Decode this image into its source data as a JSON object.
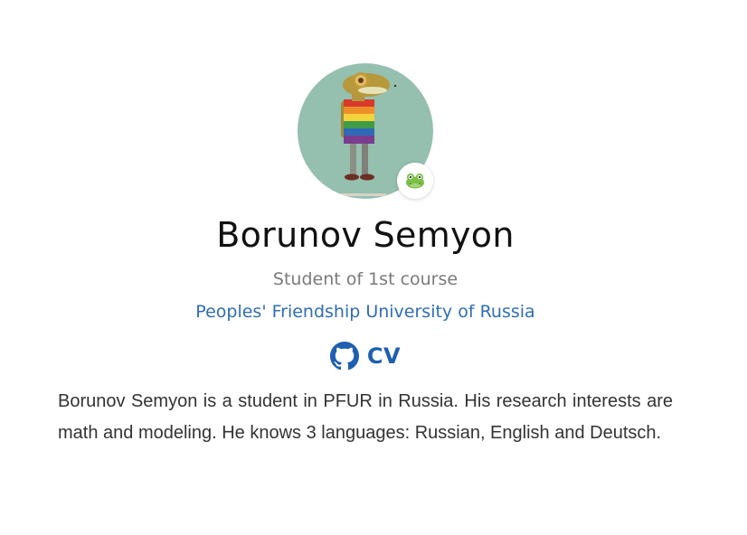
{
  "profile": {
    "name": "Borunov Semyon",
    "role": "Student of 1st course",
    "organization": "Peoples' Friendship University of Russia",
    "bio": "Borunov Semyon is a student in PFUR in Russia. His research interests are math and modeling. He knows 3 languages: Russian, English and Deutsch."
  },
  "links": {
    "github_icon": "github-icon",
    "cv_label": "CV"
  },
  "avatar": {
    "badge_emoji": "frog-icon",
    "background_color": "#95bfae"
  },
  "colors": {
    "link": "#2f6db5",
    "cv": "#1e5fb0",
    "muted": "#7a7a7a",
    "text": "#333333"
  }
}
